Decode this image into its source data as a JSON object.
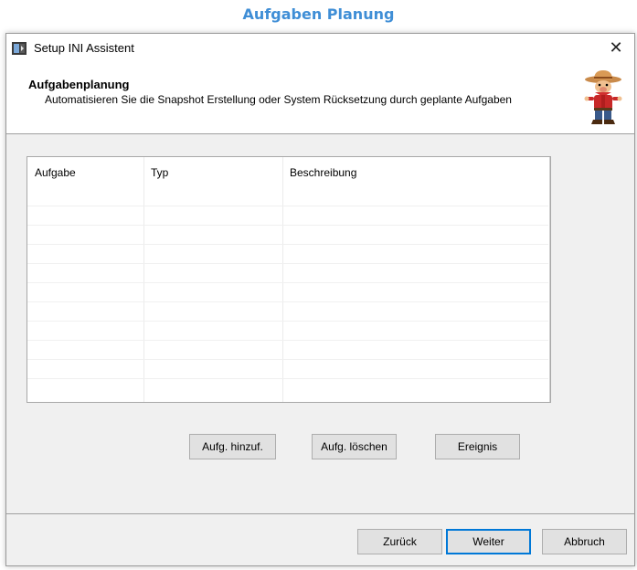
{
  "caption": "Aufgaben Planung",
  "window": {
    "title": "Setup INI Assistent",
    "close_glyph": "✕"
  },
  "header": {
    "title": "Aufgabenplanung",
    "description": "Automatisieren Sie die Snapshot Erstellung oder System Rücksetzung durch geplante Aufgaben"
  },
  "table": {
    "columns": [
      "Aufgabe",
      "Typ",
      "Beschreibung"
    ],
    "rows": []
  },
  "actions": {
    "add": "Aufg. hinzuf.",
    "delete": "Aufg. löschen",
    "event": "Ereignis"
  },
  "nav": {
    "back": "Zurück",
    "next": "Weiter",
    "cancel": "Abbruch"
  },
  "colors": {
    "caption": "#3f8ed6",
    "accent": "#0078d7"
  }
}
